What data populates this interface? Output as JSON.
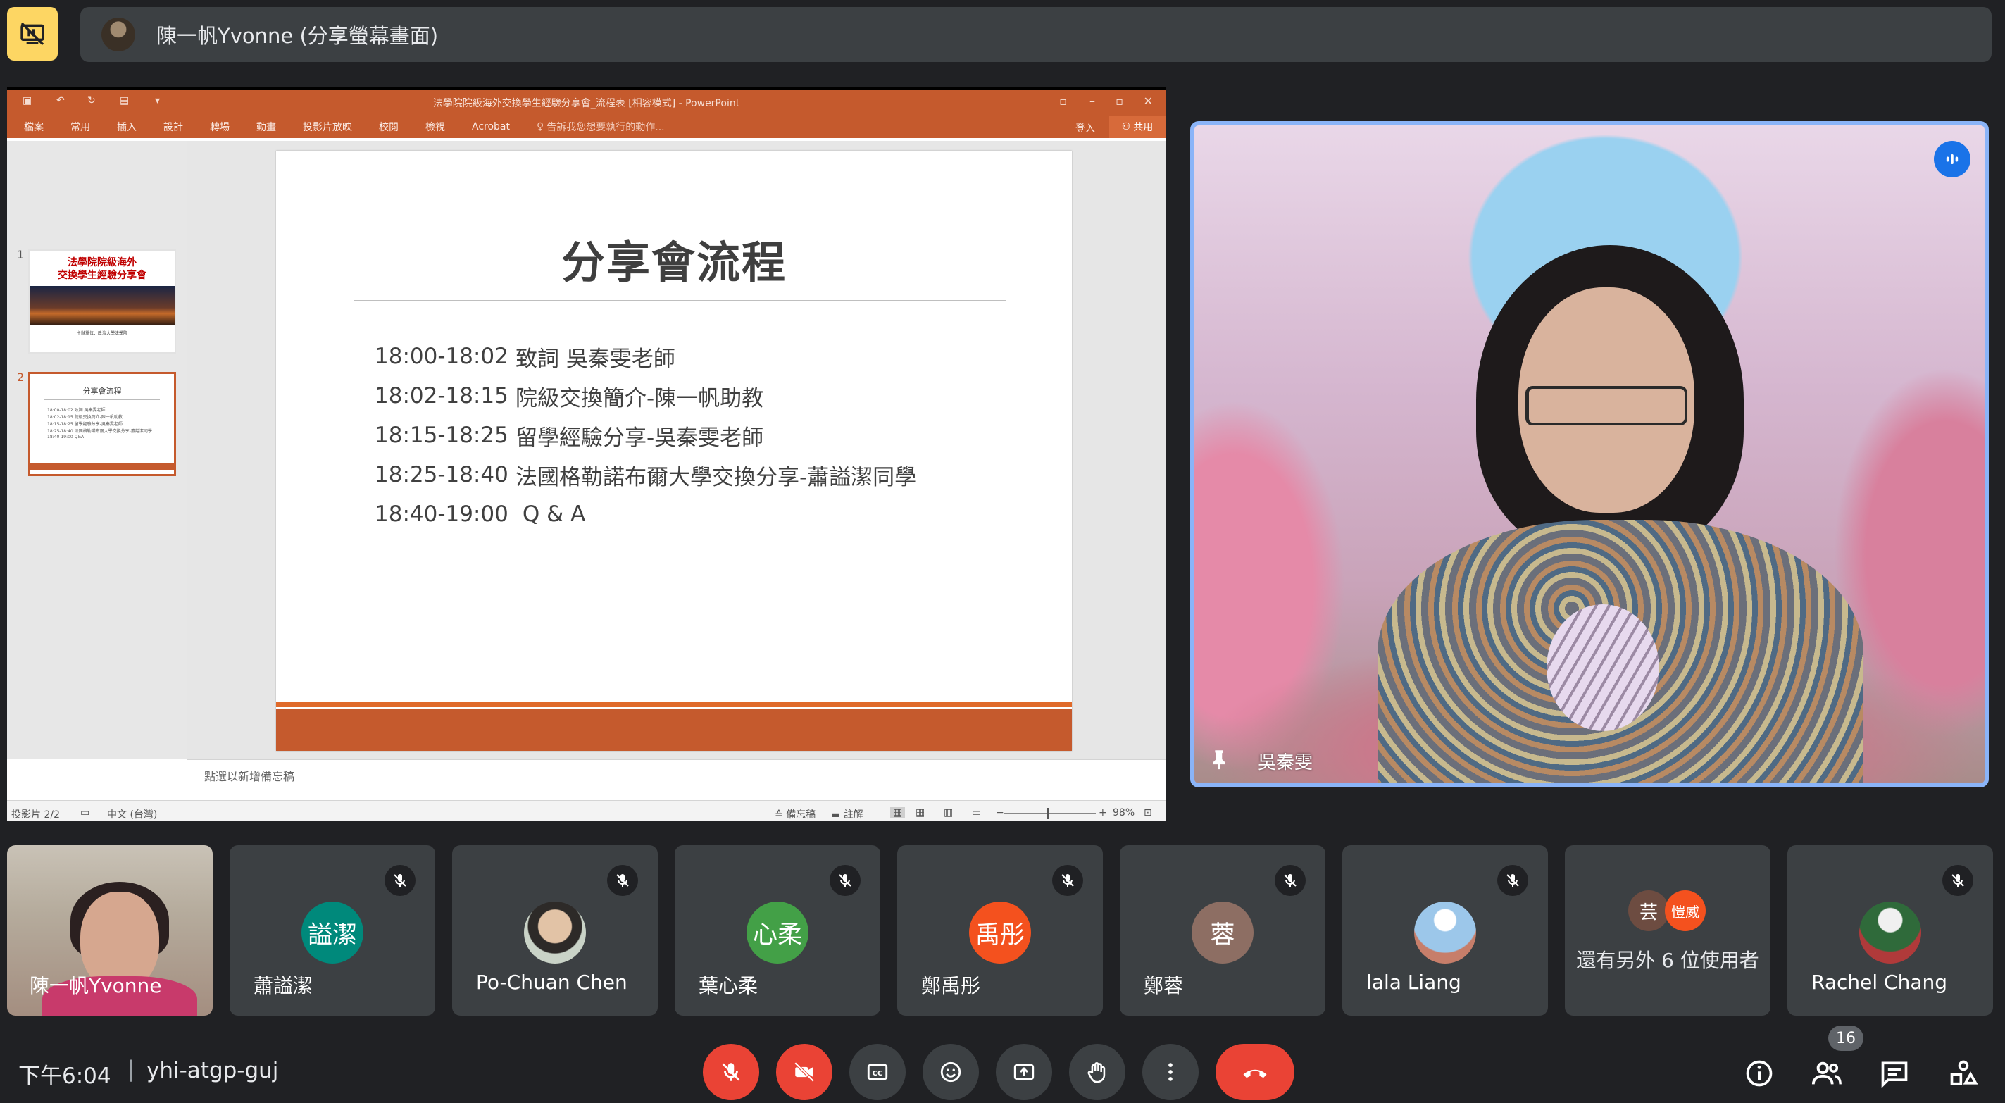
{
  "presenter_bar": {
    "name": "陳一帆Yvonne (分享螢幕畫面)"
  },
  "powerpoint": {
    "window_title": "法學院院級海外交換學生經驗分享會_流程表 [相容模式] - PowerPoint",
    "ribbon_tabs": [
      "檔案",
      "常用",
      "插入",
      "設計",
      "轉場",
      "動畫",
      "投影片放映",
      "校閱",
      "檢視",
      "Acrobat"
    ],
    "tell_me": "告訴我您想要執行的動作...",
    "sign_in": "登入",
    "share": "共用",
    "thumbnails": {
      "slide1_number": "1",
      "slide1_title": "法學院院級海外\n交換學生經驗分享會",
      "slide1_caption": "主辦單位：政治大學法學院",
      "slide2_number": "2",
      "slide2_title": "分享會流程",
      "slide2_rows": [
        "18:00-18:02 致詞 吳秦雯老師",
        "18:02-18:15 院級交換簡介-陳一帆助教",
        "18:15-18:25 留學經驗分享-吳秦雯老師",
        "18:25-18:40 法國格勒諾布爾大學交換分享-蕭謚潔同學",
        "18:40-19:00 Q&A"
      ]
    },
    "slide": {
      "title": "分享會流程",
      "agenda": [
        {
          "time": "18:00-18:02",
          "item": "致詞 吳秦雯老師"
        },
        {
          "time": "18:02-18:15",
          "item": "院級交換簡介-陳一帆助教"
        },
        {
          "time": "18:15-18:25",
          "item": "留學經驗分享-吳秦雯老師"
        },
        {
          "time": "18:25-18:40",
          "item": "法國格勒諾布爾大學交換分享-蕭謚潔同學"
        },
        {
          "time": "18:40-19:00",
          "item": " Q & A"
        }
      ]
    },
    "notes_placeholder": "點選以新增備忘稿",
    "status": {
      "slide_count": "投影片 2/2",
      "language": "中文 (台灣)",
      "notes": "備忘稿",
      "comments": "註解",
      "zoom": "98%"
    }
  },
  "speaker": {
    "name": "吳秦雯"
  },
  "participants": [
    {
      "name": "陳一帆Yvonne",
      "type": "video"
    },
    {
      "name": "蕭謚潔",
      "initials": "謚潔",
      "color": "#00897b"
    },
    {
      "name": "Po-Chuan Chen",
      "type": "photo"
    },
    {
      "name": "葉心柔",
      "initials": "心柔",
      "color": "#43a047"
    },
    {
      "name": "鄭禹彤",
      "initials": "禹彤",
      "color": "#f4511e"
    },
    {
      "name": "鄭蓉",
      "initials": "蓉",
      "color": "#8d6e63"
    },
    {
      "name": "lala Liang",
      "type": "photo"
    },
    {
      "name": "Rachel Chang",
      "type": "photo"
    }
  ],
  "others_tile": {
    "mini1": "芸",
    "mini2": "愷威",
    "mini1_color": "#6d4c41",
    "mini2_color": "#f4511e",
    "label": "還有另外 6 位使用者"
  },
  "toolbar": {
    "time": "下午6:04",
    "separator": "|",
    "meeting_code": "yhi-atgp-guj",
    "people_count": "16"
  },
  "colors": {
    "accent": "#c55a2d",
    "meet_bg": "#202124",
    "tile_bg": "#3c4043",
    "danger": "#ea4335",
    "active_speaker": "#8ab4f8",
    "presenting": "#fdd663"
  }
}
